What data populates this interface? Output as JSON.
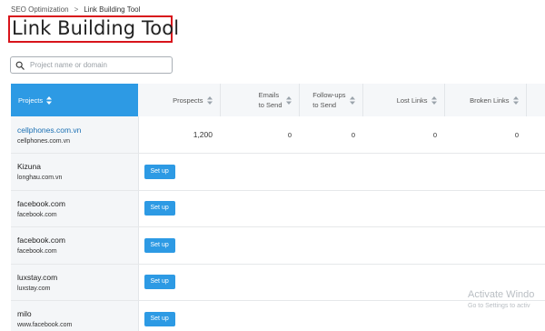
{
  "breadcrumb": {
    "items": [
      "SEO Optimization",
      "Link Building Tool"
    ],
    "separator": ">"
  },
  "page": {
    "title": "Link Building Tool",
    "highlight_color": "#d8141b"
  },
  "search": {
    "placeholder": "Project name or domain",
    "value": ""
  },
  "table": {
    "columns": [
      {
        "label": "Projects",
        "sortable": true
      },
      {
        "label": "Prospects",
        "sortable": true
      },
      {
        "label_line1": "Emails",
        "label_line2": "to Send",
        "sortable": true
      },
      {
        "label_line1": "Follow-ups",
        "label_line2": "to Send",
        "sortable": true
      },
      {
        "label": "Lost Links",
        "sortable": true
      },
      {
        "label": "Broken Links",
        "sortable": true
      }
    ],
    "rows": [
      {
        "name": "cellphones.com.vn",
        "domain": "cellphones.com.vn",
        "prospects": "1,200",
        "emails": "0",
        "followups": "0",
        "lost": "0",
        "broken": "0"
      },
      {
        "name": "Kizuna",
        "domain": "longhau.com.vn",
        "action": "Set up"
      },
      {
        "name": "facebook.com",
        "domain": "facebook.com",
        "action": "Set up"
      },
      {
        "name": "facebook.com",
        "domain": "facebook.com",
        "action": "Set up"
      },
      {
        "name": "luxstay.com",
        "domain": "luxstay.com",
        "action": "Set up"
      },
      {
        "name": "milo",
        "domain": "www.facebook.com",
        "action": "Set up"
      }
    ]
  },
  "watermark": {
    "line1": "Activate Windo",
    "line2": "Go to Settings to activ"
  },
  "colors": {
    "accent": "#2d9ae4",
    "link": "#1a6fb3"
  }
}
